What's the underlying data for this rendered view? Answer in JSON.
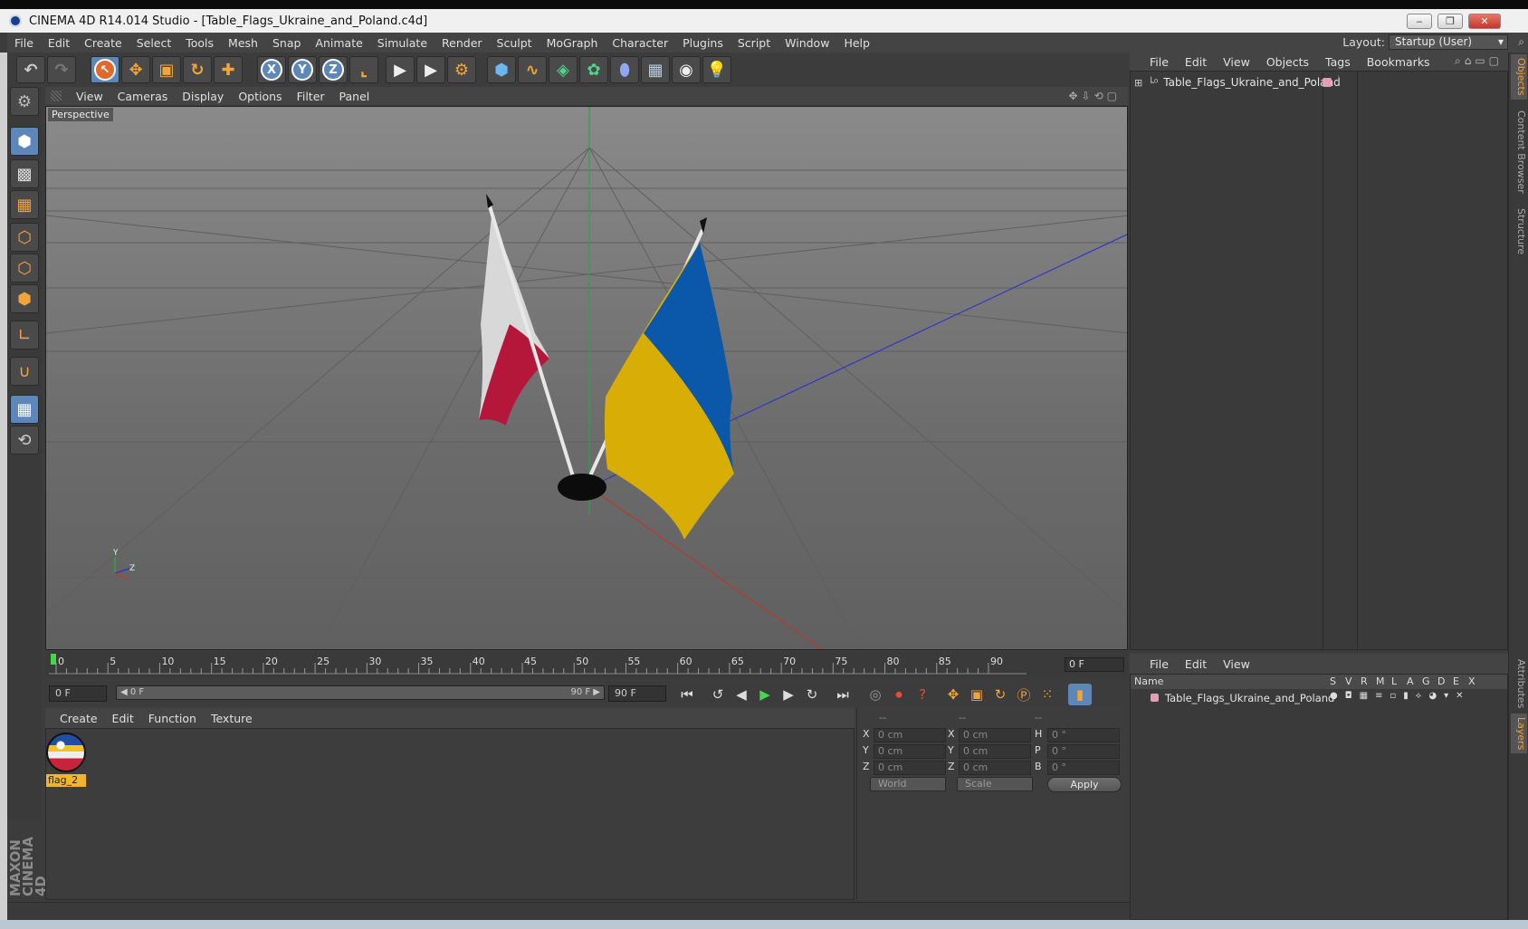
{
  "window": {
    "title": "CINEMA 4D R14.014 Studio - [Table_Flags_Ukraine_and_Poland.c4d]",
    "min": "‒",
    "max": "❐",
    "close": "✕"
  },
  "menu": [
    "File",
    "Edit",
    "Create",
    "Select",
    "Tools",
    "Mesh",
    "Snap",
    "Animate",
    "Simulate",
    "Render",
    "Sculpt",
    "MoGraph",
    "Character",
    "Plugins",
    "Script",
    "Window",
    "Help"
  ],
  "layout": {
    "label": "Layout:",
    "value": "Startup (User)"
  },
  "toolbar": {
    "undo": "↶",
    "redo": "↷",
    "live_select": "↖",
    "move": "✥",
    "scale": "▣",
    "rotate": "↻",
    "last_tool": "✚",
    "axis_x": "X",
    "axis_y": "Y",
    "axis_z": "Z",
    "coord_system": "⌞",
    "render_view": "▶",
    "render_picture": "▶",
    "render_settings": "⚙",
    "cube": "⬢",
    "spline": "∿",
    "nurbs": "◈",
    "array": "✿",
    "deformer": "⬮",
    "floor": "▦",
    "camera": "◉",
    "light": "💡"
  },
  "viewport": {
    "menu": [
      "View",
      "Cameras",
      "Display",
      "Options",
      "Filter",
      "Panel"
    ],
    "label": "Perspective",
    "nav_icons": "✥⇩⟲▢",
    "axis_y": "Y",
    "axis_z": "Z"
  },
  "timeline": {
    "ticks": [
      "0",
      "5",
      "10",
      "15",
      "20",
      "25",
      "30",
      "35",
      "40",
      "45",
      "50",
      "55",
      "60",
      "65",
      "70",
      "75",
      "80",
      "85",
      "90"
    ],
    "current_frame": "0 F"
  },
  "transport": {
    "start": "0 F",
    "slider_left": "◀ 0 F",
    "slider_right": "90 F ▶",
    "end": "90 F",
    "first": "⏮",
    "prev_key": "↺",
    "prev": "◀",
    "play": "▶",
    "next": "▶",
    "next_key": "↻",
    "last": "⏭"
  },
  "materials": {
    "menu": [
      "Create",
      "Edit",
      "Function",
      "Texture"
    ],
    "items": [
      {
        "name": "flag_2"
      }
    ]
  },
  "coords": {
    "headers": [
      "--",
      "--",
      "--"
    ],
    "rows": [
      {
        "a": "X",
        "av": "0 cm",
        "b": "X",
        "bv": "0 cm",
        "c": "H",
        "cv": "0 °"
      },
      {
        "a": "Y",
        "av": "0 cm",
        "b": "Y",
        "bv": "0 cm",
        "c": "P",
        "cv": "0 °"
      },
      {
        "a": "Z",
        "av": "0 cm",
        "b": "Z",
        "bv": "0 cm",
        "c": "B",
        "cv": "0 °"
      }
    ],
    "mode": "World",
    "transform": "Scale",
    "apply": "Apply"
  },
  "objects": {
    "menu": [
      "File",
      "Edit",
      "View",
      "Objects",
      "Tags",
      "Bookmarks"
    ],
    "items": [
      {
        "name": "Table_Flags_Ukraine_and_Poland"
      }
    ]
  },
  "layers": {
    "menu": [
      "File",
      "Edit",
      "View"
    ],
    "columns": {
      "name": "Name",
      "flags": [
        "S",
        "V",
        "R",
        "M",
        "L",
        "A",
        "G",
        "D",
        "E",
        "X"
      ]
    },
    "items": [
      {
        "name": "Table_Flags_Ukraine_and_Poland"
      }
    ]
  },
  "side_tabs": [
    "Objects",
    "Content Browser",
    "Structure",
    "Attributes",
    "Layers"
  ],
  "brand": "MAXON CINEMA 4D",
  "colors": {
    "accent_select": "#5c87b8",
    "material_label": "#f6b42a",
    "layer_color": "#e79bb5"
  }
}
